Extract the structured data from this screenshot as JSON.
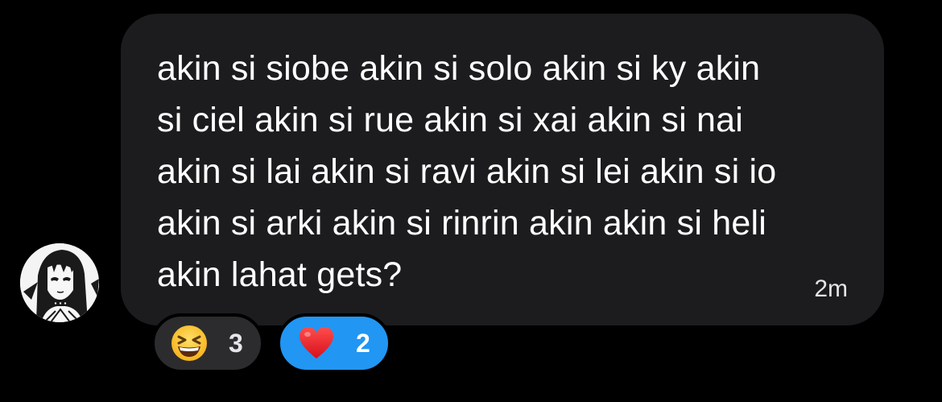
{
  "message": {
    "text": "akin si siobe akin si solo akin si ky akin\nsi ciel akin si rue akin si xai akin si nai\nakin si lai akin si ravi akin si lei akin si io\nakin si arki akin si rinrin akin  akin si heli\nakin lahat gets?",
    "timestamp": "2m",
    "bubble_color": "#1c1c1e",
    "text_color": "#ffffff"
  },
  "avatar": {
    "icon": "manga-girl-avatar-icon"
  },
  "reactions": [
    {
      "emoji": "grinning-squinting-face-icon",
      "count": "3",
      "selected": false,
      "color": "#2c2c2e"
    },
    {
      "emoji": "red-heart-icon",
      "count": "2",
      "selected": true,
      "color": "#2196f3"
    }
  ]
}
